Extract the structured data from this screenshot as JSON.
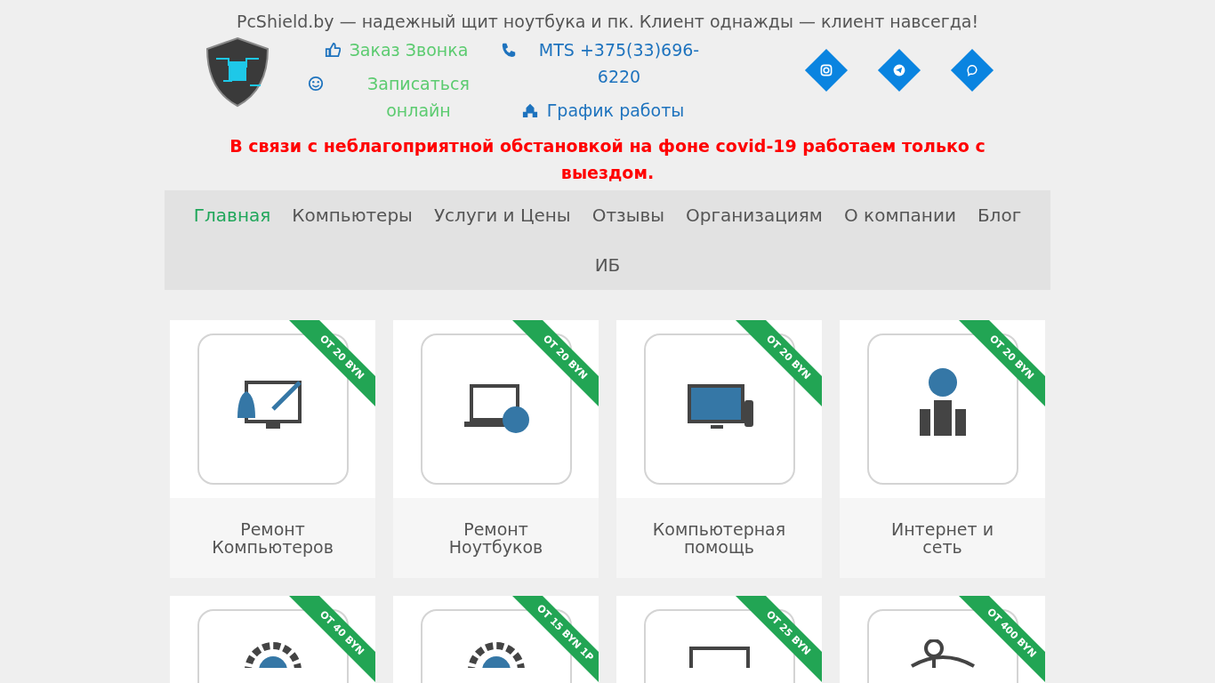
{
  "tagline": "PcShield.by — надежный щит ноутбука и пк. Клиент однажды — клиент навсегда!",
  "contacts": {
    "callback": "Заказ Звонка",
    "signup": "Записаться онлайн",
    "phone": "MTS +375(33)696-6220",
    "schedule": "График работы"
  },
  "socials": [
    {
      "kind": "instagram"
    },
    {
      "kind": "telegram"
    },
    {
      "kind": "viber"
    }
  ],
  "notice": "В связи с неблагоприятной обстановкой на фоне covid-19 работаем только с выездом.",
  "menu": [
    {
      "label": "Главная",
      "selected": true
    },
    {
      "label": "Компьютеры",
      "selected": false
    },
    {
      "label": "Услуги и Цены",
      "selected": false
    },
    {
      "label": "Отзывы",
      "selected": false
    },
    {
      "label": "Организациям",
      "selected": false
    },
    {
      "label": "О компании",
      "selected": false
    },
    {
      "label": "Блог",
      "selected": false
    },
    {
      "label": "ИБ",
      "selected": false
    }
  ],
  "services": [
    {
      "kind": "desktop",
      "title": "Ремонт Компьютеров",
      "ribbon": "ОТ 20 BYN"
    },
    {
      "kind": "laptop",
      "title": "Ремонт Ноутбуков",
      "ribbon": "ОТ 20 BYN"
    },
    {
      "kind": "error",
      "title": "Компьютерная помощь",
      "ribbon": "ОТ 20 BYN"
    },
    {
      "kind": "people",
      "title": "Интернет и сеть",
      "ribbon": "ОТ 20 BYN"
    },
    {
      "kind": "gear",
      "ribbon": "ОТ 40 BYN"
    },
    {
      "kind": "gear",
      "ribbon": "ОТ 15 BYN 1P"
    },
    {
      "kind": "monitor",
      "ribbon": "ОТ 25 BYN"
    },
    {
      "kind": "person",
      "ribbon": "ОТ 400 BYN"
    }
  ]
}
